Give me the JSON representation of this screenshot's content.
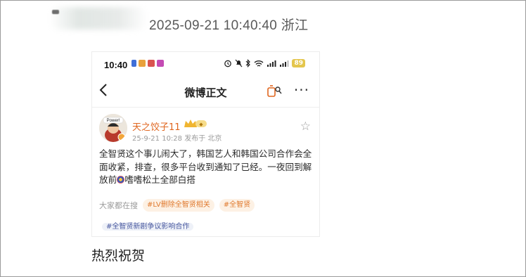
{
  "post": {
    "timestamp_location": "2025-09-21 10:40:40 浙江",
    "caption": "热烈祝贺"
  },
  "phone": {
    "status_bar": {
      "time": "10:40",
      "battery": "89"
    },
    "nav": {
      "back_icon": "chevron-left-icon",
      "title": "微博正文",
      "share_icon": "share-icon",
      "more_label": "···"
    },
    "weibo": {
      "author": {
        "name": "天之饺子11",
        "vip_badge": "crown-vip-icon",
        "avatar_badge": "Power!"
      },
      "meta": "25-9-21 10:28  发布于 北京",
      "text_before": "全智贤这个事儿闹大了，韩国艺人和韩国公司合作会全面收紧，排查，很多平台收到通知了已经。一夜回到解放前",
      "text_after": "嗜嗜松土全部白搭",
      "search": {
        "label": "大家都在搜",
        "tags": [
          "#LV删除全智贤相关",
          "#全智贤",
          "#全智贤新剧争议影响合作"
        ]
      }
    }
  },
  "colors": {
    "accent_orange": "#e0661f",
    "tag_orange": "#e07a2f",
    "tag_blue": "#4a5aa0"
  }
}
